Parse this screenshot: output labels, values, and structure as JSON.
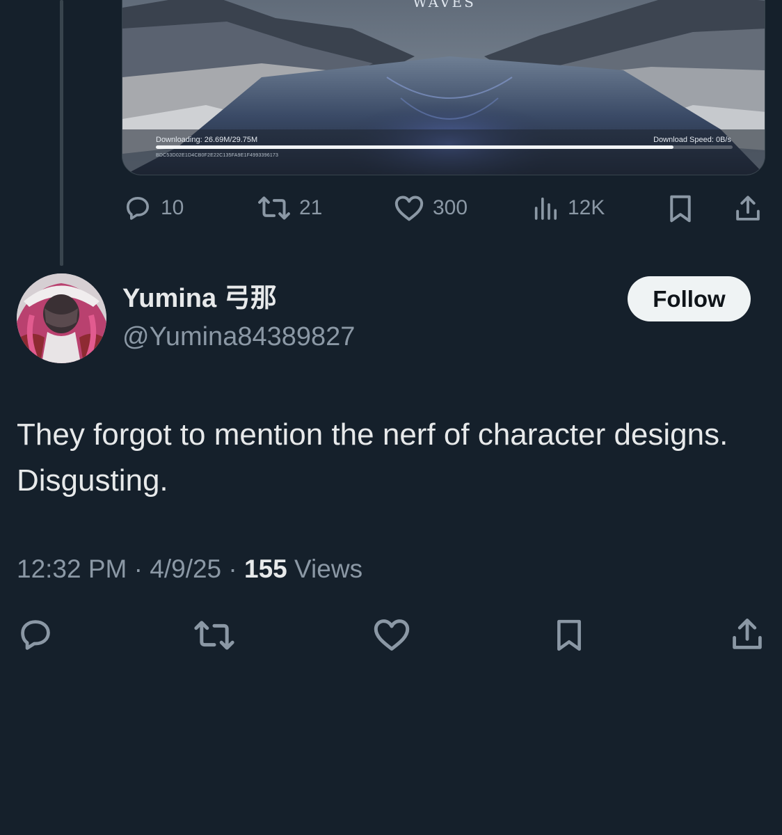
{
  "media": {
    "game_logo": "WAVES",
    "download_status": "Downloading: 26.69M/29.75M",
    "download_speed": "Download Speed: 0B/s",
    "download_progress": 0.897,
    "download_hash": "BDC53D02E1D4CB0F2E22C135FA9E1F4993396173"
  },
  "parent_actions": {
    "replies": "10",
    "reposts": "21",
    "likes": "300",
    "views": "12K"
  },
  "tweet": {
    "display_name": "Yumina 弓那",
    "handle": "@Yumina84389827",
    "follow_label": "Follow",
    "text": "They forgot to mention the nerf of character designs. Disgusting.",
    "time": "12:32 PM",
    "date": "4/9/25",
    "separator": "·",
    "views_count": "155",
    "views_label": "Views"
  },
  "colors": {
    "background": "#15202b",
    "text_primary": "#e7e9ea",
    "text_secondary": "#8b98a5",
    "follow_button_bg": "#eff3f4"
  },
  "icons": [
    "reply-icon",
    "repost-icon",
    "like-icon",
    "views-icon",
    "bookmark-icon",
    "share-icon"
  ]
}
